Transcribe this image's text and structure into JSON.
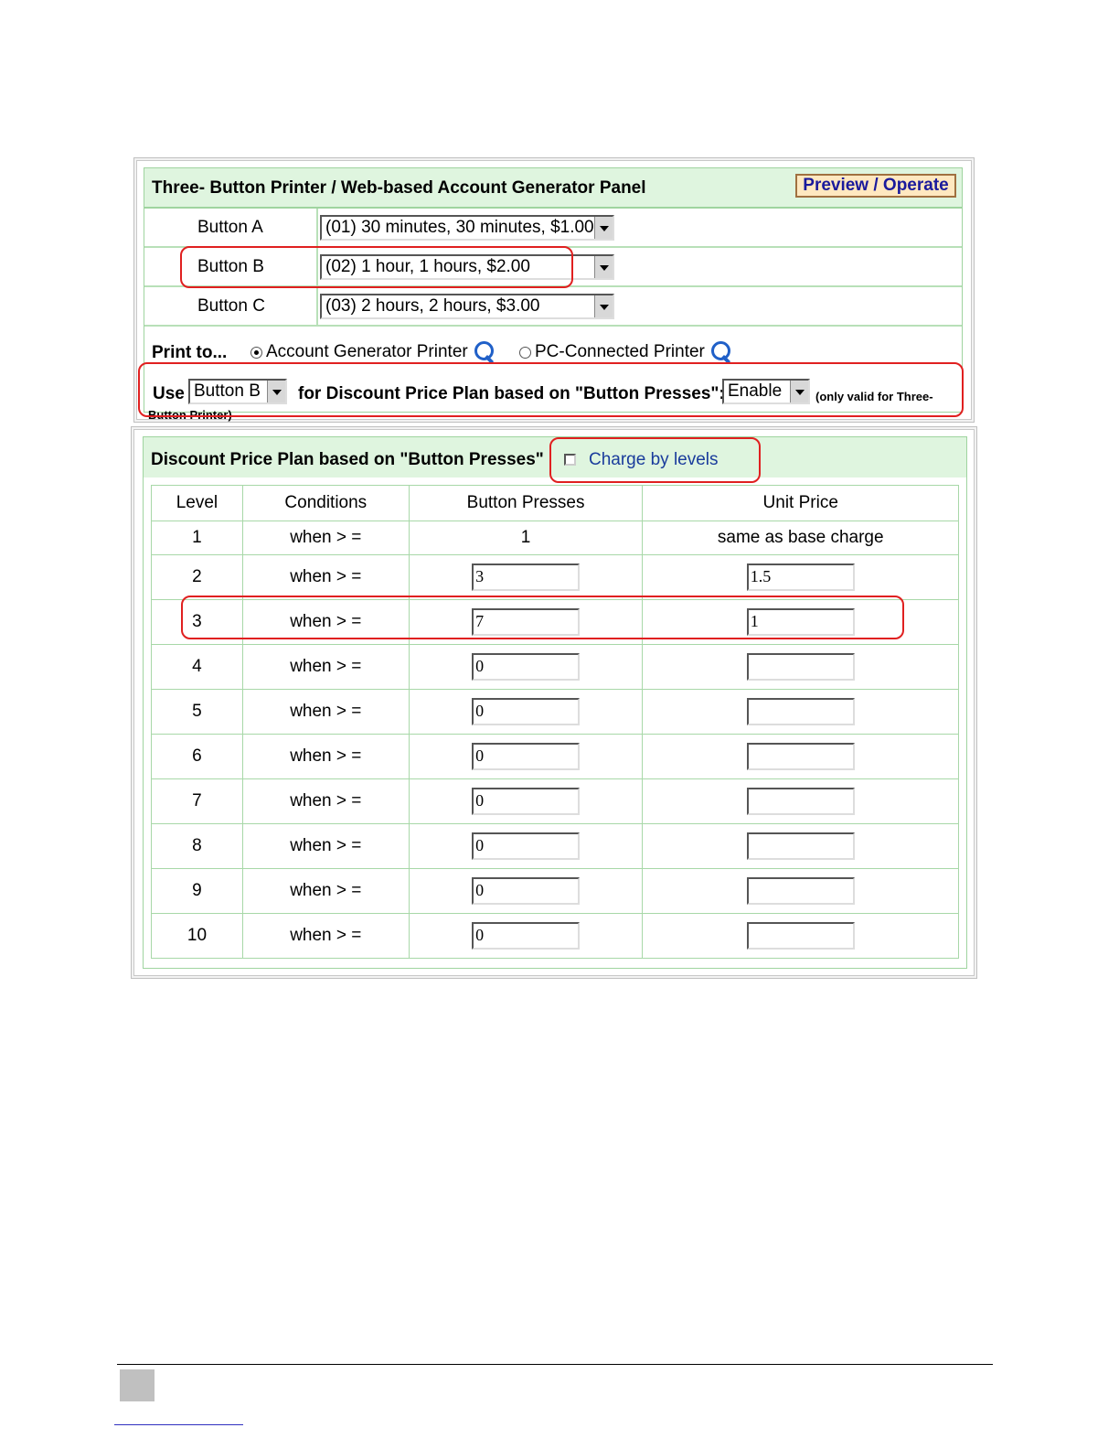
{
  "generator_panel": {
    "title": "Three- Button Printer / Web-based Account Generator Panel",
    "preview_button": "Preview / Operate",
    "buttons": [
      {
        "label": "Button A",
        "value": "(01) 30 minutes, 30 minutes, $1.00"
      },
      {
        "label": "Button B",
        "value": "(02) 1 hour, 1 hours, $2.00"
      },
      {
        "label": "Button C",
        "value": "(03) 2 hours, 2 hours, $3.00"
      }
    ],
    "print_to_label": "Print to...",
    "print_options": [
      {
        "label": "Account Generator Printer",
        "selected": true
      },
      {
        "label": "PC-Connected Printer",
        "selected": false
      }
    ],
    "discount_row": {
      "use_label": "Use",
      "button_select": "Button B",
      "middle_text": "for Discount Price Plan based on \"Button Presses\":",
      "enable_select": "Enable",
      "note_part1": "(only valid for Three-",
      "note_part2": "Button Printer)"
    }
  },
  "discount_plan": {
    "title": "Discount Price Plan based on \"Button Presses\"",
    "charge_by_levels_label": "Charge by levels",
    "charge_by_levels_checked": false,
    "columns": [
      "Level",
      "Conditions",
      "Button Presses",
      "Unit Price"
    ],
    "rows": [
      {
        "level": "1",
        "condition": "when > =",
        "presses": "1",
        "unit_price": "same as base charge"
      },
      {
        "level": "2",
        "condition": "when > =",
        "presses": "3",
        "unit_price": "1.5"
      },
      {
        "level": "3",
        "condition": "when > =",
        "presses": "7",
        "unit_price": "1"
      },
      {
        "level": "4",
        "condition": "when > =",
        "presses": "0",
        "unit_price": ""
      },
      {
        "level": "5",
        "condition": "when > =",
        "presses": "0",
        "unit_price": ""
      },
      {
        "level": "6",
        "condition": "when > =",
        "presses": "0",
        "unit_price": ""
      },
      {
        "level": "7",
        "condition": "when > =",
        "presses": "0",
        "unit_price": ""
      },
      {
        "level": "8",
        "condition": "when > =",
        "presses": "0",
        "unit_price": ""
      },
      {
        "level": "9",
        "condition": "when > =",
        "presses": "0",
        "unit_price": ""
      },
      {
        "level": "10",
        "condition": "when > =",
        "presses": "0",
        "unit_price": ""
      }
    ]
  },
  "icons": {
    "search": "magnifier-icon",
    "dropdown": "chevron-down-icon"
  },
  "colors": {
    "header_bg": "#dff5df",
    "grid_green": "#9fd49f",
    "highlight_red": "#e02020",
    "preview_text": "#1a1a9c"
  }
}
